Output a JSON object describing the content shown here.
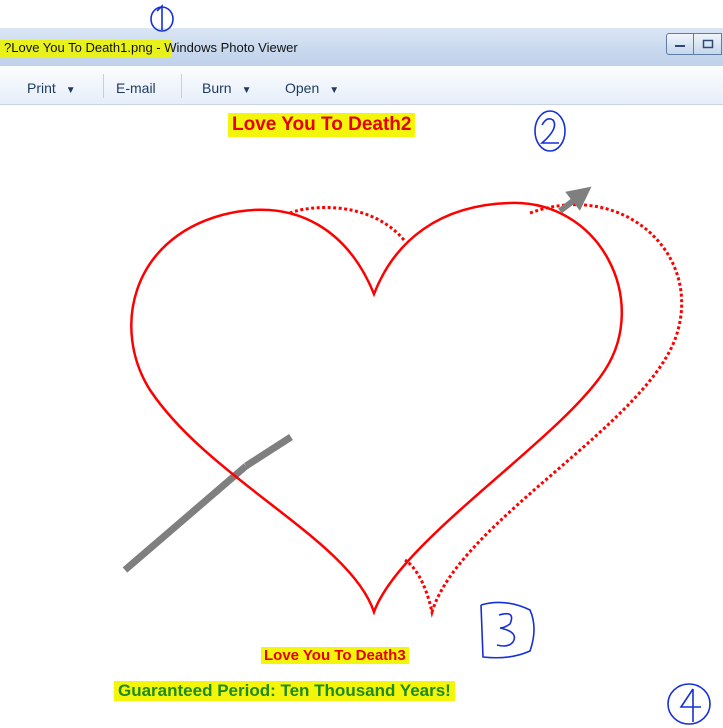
{
  "window": {
    "title_prefix": "?",
    "title_highlight": "Love You To Death1",
    "title_rest": ".png - Windows Photo Viewer",
    "minimize_icon": "minimize-icon",
    "maximize_icon": "maximize-icon"
  },
  "toolbar": {
    "print_label": "Print",
    "email_label": "E-mail",
    "burn_label": "Burn",
    "open_label": "Open",
    "caret": "▼"
  },
  "image": {
    "heading_top": "Love You To Death2",
    "heading_bottom": "Love You To Death3",
    "tagline": "Guaranteed Period: Ten Thousand Years!",
    "heart_color": "#ff0000",
    "arrow_color": "#7f7f7f",
    "highlight_color": "#f3f60a",
    "tagline_color": "#1f8a1f"
  },
  "annotations": {
    "marks": [
      "1",
      "2",
      "3",
      "4"
    ],
    "ink_color": "#1630d8"
  }
}
